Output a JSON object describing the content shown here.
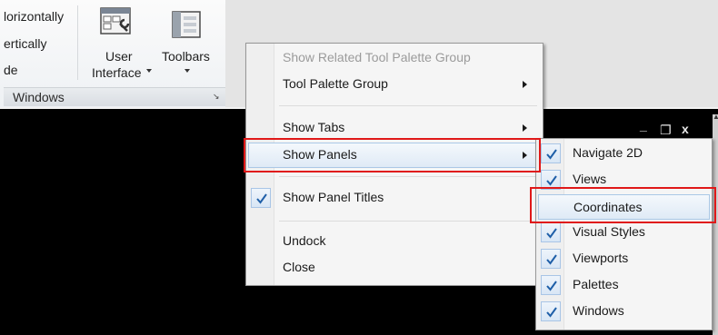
{
  "ribbon": {
    "item_horizontally": "lorizontally",
    "item_vertically": "ertically",
    "item_cascade": "de",
    "user_interface_label_line1": "User",
    "user_interface_label_line2": "Interface",
    "toolbars_label": "Toolbars",
    "panel_title": "Windows"
  },
  "context_menu": {
    "items": [
      {
        "label": "Show Related Tool Palette Group",
        "enabled": false
      },
      {
        "label": "Tool Palette Group",
        "submenu": true
      },
      {
        "label": "Show Tabs",
        "submenu": true
      },
      {
        "label": "Show Panels",
        "submenu": true,
        "highlighted": true
      },
      {
        "label": "Show Panel Titles",
        "checked": true
      },
      {
        "label": "Undock"
      },
      {
        "label": "Close"
      }
    ]
  },
  "panels_submenu": {
    "items": [
      {
        "label": "Navigate 2D",
        "checked": true
      },
      {
        "label": "Views",
        "checked": true
      },
      {
        "label": "Coordinates",
        "checked": false,
        "highlighted": true
      },
      {
        "label": "Visual Styles",
        "checked": true
      },
      {
        "label": "Viewports",
        "checked": true
      },
      {
        "label": "Palettes",
        "checked": true
      },
      {
        "label": "Windows",
        "checked": true
      }
    ]
  },
  "window_controls": {
    "minimize": "_",
    "restore": "❐",
    "close": "x"
  },
  "colors": {
    "highlight_outline": "#e01818",
    "check_color": "#1f5fa8",
    "canvas": "#000000"
  }
}
